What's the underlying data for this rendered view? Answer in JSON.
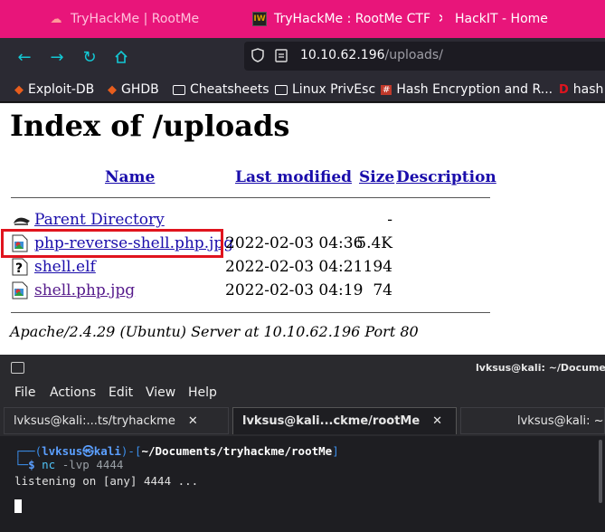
{
  "browser": {
    "tabs": [
      {
        "title": "TryHackMe | RootMe",
        "favicon": "tryhackme-icon"
      },
      {
        "title": "TryHackMe : RootMe CTF",
        "favicon": "writeup-icon"
      },
      {
        "title": "HackIT - Home"
      }
    ],
    "url": {
      "host": "10.10.62.196",
      "path": "/uploads/"
    },
    "bookmarks": [
      "Exploit-DB",
      "GHDB",
      "Cheatsheets",
      "Linux PrivEsc",
      "Hash Encryption and R...",
      "hash"
    ]
  },
  "page": {
    "title": "Index of /uploads",
    "headers": {
      "name": "Name",
      "modified": "Last modified",
      "size": "Size",
      "description": "Description"
    },
    "parent": {
      "name": "Parent Directory",
      "size": "-"
    },
    "files": [
      {
        "name": "php-reverse-shell.php.jpg",
        "modified": "2022-02-03 04:36",
        "size": "5.4K",
        "icon": "image-file-icon"
      },
      {
        "name": "shell.elf",
        "modified": "2022-02-03 04:21",
        "size": "194",
        "icon": "unknown-file-icon"
      },
      {
        "name": "shell.php.jpg",
        "modified": "2022-02-03 04:19",
        "size": "74",
        "icon": "image-file-icon"
      }
    ],
    "address": "Apache/2.4.29 (Ubuntu) Server at 10.10.62.196 Port 80"
  },
  "terminal": {
    "window_title": "lvksus@kali: ~/Documents",
    "menu": [
      "File",
      "Actions",
      "Edit",
      "View",
      "Help"
    ],
    "tabs": [
      {
        "label": "lvksus@kali:...ts/tryhackme"
      },
      {
        "label": "lvksus@kali...ckme/rootMe"
      },
      {
        "label": "lvksus@kali: ~"
      }
    ],
    "prompt_user": "lvksus",
    "prompt_at": "㉿",
    "prompt_host": "kali",
    "prompt_path": "~/Documents/tryhackme/rootMe",
    "command": "nc",
    "command_args": "-lvp 4444",
    "output": "listening on [any] 4444 ..."
  }
}
